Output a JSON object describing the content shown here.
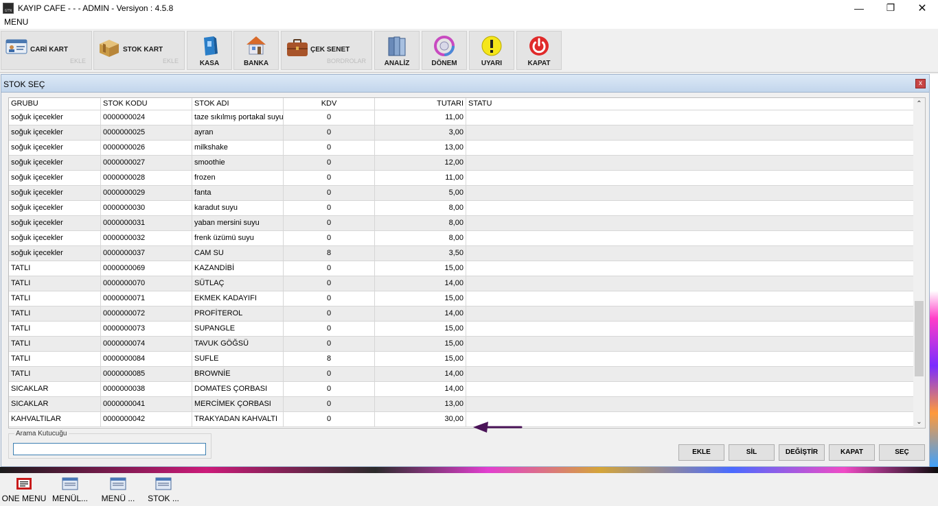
{
  "window": {
    "title": "KAYIP CAFE -  -  - ADMIN -  Versiyon : 4.5.8",
    "controls": {
      "minimize": "—",
      "maximize": "❐",
      "close": "✕"
    }
  },
  "menubar": {
    "menu": "MENU"
  },
  "toolbar": {
    "cari_kart": {
      "label": "CARİ KART",
      "sub": "EKLE"
    },
    "stok_kart": {
      "label": "STOK KART",
      "sub": "EKLE"
    },
    "kasa": {
      "label": "KASA"
    },
    "banka": {
      "label": "BANKA"
    },
    "cek_senet": {
      "label": "ÇEK SENET",
      "sub": "BORDROLAR"
    },
    "analiz": {
      "label": "ANALİZ"
    },
    "donem": {
      "label": "DÖNEM"
    },
    "uyari": {
      "label": "UYARI"
    },
    "kapat": {
      "label": "KAPAT"
    }
  },
  "dialog": {
    "title": "STOK SEÇ",
    "close": "x",
    "columns": [
      "GRUBU",
      "STOK KODU",
      "STOK ADI",
      "KDV",
      "TUTARI",
      "STATU"
    ],
    "rows": [
      {
        "grp": "soğuk içecekler",
        "code": "0000000024",
        "name": "taze sıkılmış portakal suyu",
        "kdv": "0",
        "amt": "11,00",
        "stat": ""
      },
      {
        "grp": "soğuk içecekler",
        "code": "0000000025",
        "name": "ayran",
        "kdv": "0",
        "amt": "3,00",
        "stat": ""
      },
      {
        "grp": "soğuk içecekler",
        "code": "0000000026",
        "name": "milkshake",
        "kdv": "0",
        "amt": "13,00",
        "stat": ""
      },
      {
        "grp": "soğuk içecekler",
        "code": "0000000027",
        "name": "smoothie",
        "kdv": "0",
        "amt": "12,00",
        "stat": ""
      },
      {
        "grp": "soğuk içecekler",
        "code": "0000000028",
        "name": "frozen",
        "kdv": "0",
        "amt": "11,00",
        "stat": ""
      },
      {
        "grp": "soğuk içecekler",
        "code": "0000000029",
        "name": "fanta",
        "kdv": "0",
        "amt": "5,00",
        "stat": ""
      },
      {
        "grp": "soğuk içecekler",
        "code": "0000000030",
        "name": "karadut suyu",
        "kdv": "0",
        "amt": "8,00",
        "stat": ""
      },
      {
        "grp": "soğuk içecekler",
        "code": "0000000031",
        "name": "yaban mersini suyu",
        "kdv": "0",
        "amt": "8,00",
        "stat": ""
      },
      {
        "grp": "soğuk içecekler",
        "code": "0000000032",
        "name": "frenk üzümü suyu",
        "kdv": "0",
        "amt": "8,00",
        "stat": ""
      },
      {
        "grp": "soğuk içecekler",
        "code": "0000000037",
        "name": "CAM SU",
        "kdv": "8",
        "amt": "3,50",
        "stat": ""
      },
      {
        "grp": "TATLI",
        "code": "0000000069",
        "name": "KAZANDİBİ",
        "kdv": "0",
        "amt": "15,00",
        "stat": ""
      },
      {
        "grp": "TATLI",
        "code": "0000000070",
        "name": "SÜTLAÇ",
        "kdv": "0",
        "amt": "14,00",
        "stat": ""
      },
      {
        "grp": "TATLI",
        "code": "0000000071",
        "name": "EKMEK KADAYIFI",
        "kdv": "0",
        "amt": "15,00",
        "stat": ""
      },
      {
        "grp": "TATLI",
        "code": "0000000072",
        "name": "PROFİTEROL",
        "kdv": "0",
        "amt": "14,00",
        "stat": ""
      },
      {
        "grp": "TATLI",
        "code": "0000000073",
        "name": "SUPANGLE",
        "kdv": "0",
        "amt": "15,00",
        "stat": ""
      },
      {
        "grp": "TATLI",
        "code": "0000000074",
        "name": "TAVUK GÖĞSÜ",
        "kdv": "0",
        "amt": "15,00",
        "stat": ""
      },
      {
        "grp": "TATLI",
        "code": "0000000084",
        "name": "SUFLE",
        "kdv": "8",
        "amt": "15,00",
        "stat": ""
      },
      {
        "grp": "TATLI",
        "code": "0000000085",
        "name": "BROWNİE",
        "kdv": "0",
        "amt": "14,00",
        "stat": ""
      },
      {
        "grp": "SICAKLAR",
        "code": "0000000038",
        "name": "DOMATES ÇORBASI",
        "kdv": "0",
        "amt": "14,00",
        "stat": ""
      },
      {
        "grp": "SICAKLAR",
        "code": "0000000041",
        "name": "MERCİMEK ÇORBASI",
        "kdv": "0",
        "amt": "13,00",
        "stat": ""
      },
      {
        "grp": "KAHVALTILAR",
        "code": "0000000042",
        "name": "TRAKYADAN KAHVALTI",
        "kdv": "0",
        "amt": "30,00",
        "stat": ""
      }
    ],
    "search": {
      "legend": "Arama Kutucuğu",
      "value": ""
    },
    "buttons": {
      "ekle": "EKLE",
      "sil": "SİL",
      "degistir": "DEĞİŞTİR",
      "kapat": "KAPAT",
      "sec": "SEÇ"
    },
    "arrow_color": "#4b1458"
  },
  "taskbar": {
    "items": [
      "ONE MENU",
      "MENÜL...",
      "MENÜ ...",
      "STOK ..."
    ]
  }
}
